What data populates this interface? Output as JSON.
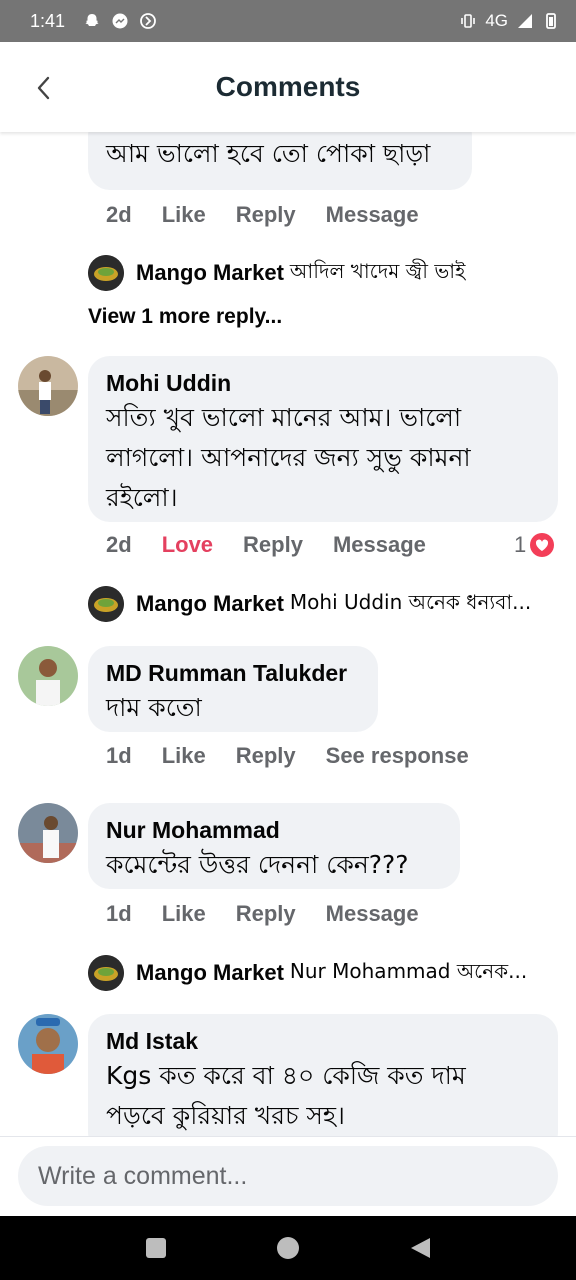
{
  "status_bar": {
    "time": "1:41",
    "network": "4G"
  },
  "header": {
    "title": "Comments"
  },
  "top_partial": {
    "text": "আম ভালো হবে তো পোকা ছাড়া"
  },
  "comments": [
    {
      "actions": {
        "time": "2d",
        "like": "Like",
        "reply": "Reply",
        "third": "Message"
      },
      "reply_preview": {
        "name": "Mango Market",
        "text": "আদিল খাদেম জ্বী ভাই"
      },
      "more_replies": "View 1 more reply..."
    },
    {
      "name": "Mohi Uddin",
      "text_lines": [
        "সত্যি খুব ভালো মানের আম। ভালো",
        "লাগলো। আপনাদের জন্য সুভু কামনা",
        "রইলো।"
      ],
      "actions": {
        "time": "2d",
        "like": "Love",
        "reply": "Reply",
        "third": "Message"
      },
      "reaction_count": "1",
      "reply_preview": {
        "name": "Mango Market",
        "text": "Mohi Uddin অনেক ধন্যবা..."
      }
    },
    {
      "name": "MD Rumman Talukder",
      "text_lines": [
        "দাম কতো"
      ],
      "actions": {
        "time": "1d",
        "like": "Like",
        "reply": "Reply",
        "third": "See response"
      }
    },
    {
      "name": "Nur Mohammad",
      "text_lines": [
        "কমেন্টের উত্তর দেননা কেন???"
      ],
      "actions": {
        "time": "1d",
        "like": "Like",
        "reply": "Reply",
        "third": "Message"
      },
      "reply_preview": {
        "name": "Mango Market",
        "text": "Nur Mohammad অনেক..."
      }
    },
    {
      "name": "Md Istak",
      "text_lines": [
        "Kgs কত করে বা ৪০ কেজি কত দাম",
        "পড়বে কুরিয়ার খরচ সহ।"
      ]
    }
  ],
  "composer": {
    "placeholder": "Write a comment..."
  },
  "colors": {
    "love": "#e4405f",
    "bubble": "#f0f2f5",
    "muted": "#65676b",
    "heart": "#f33e58"
  },
  "icons": [
    "back-arrow-icon",
    "heart-reaction-icon",
    "square-nav-icon",
    "circle-nav-icon",
    "triangle-nav-icon"
  ]
}
